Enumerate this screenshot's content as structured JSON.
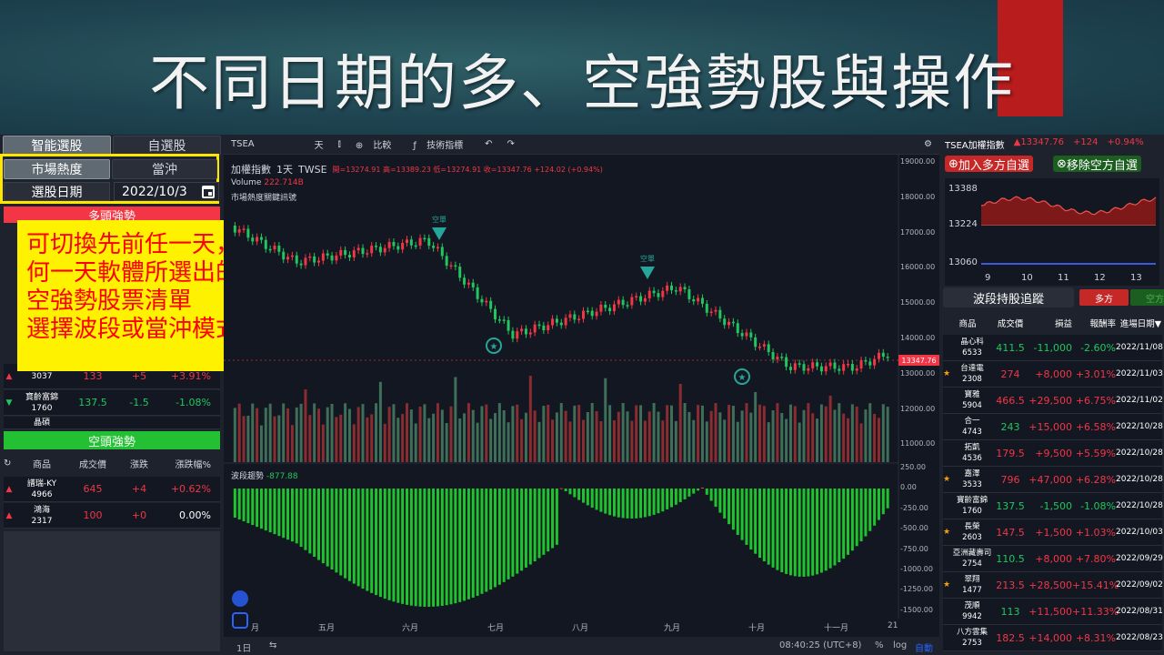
{
  "slide": {
    "title": "不同日期的多、空強勢股與操作"
  },
  "left_panel": {
    "tabs": [
      "智能選股",
      "自選股"
    ],
    "mode_tabs": [
      "市場熱度",
      "當沖"
    ],
    "date_label": "選股日期",
    "date_value": "2022/10/3",
    "bull_title": "多頭強勢",
    "bull_rows": [
      {
        "name": "",
        "code": "3037",
        "price": "133",
        "change": "+5",
        "pct": "+3.91%",
        "dir": "up"
      },
      {
        "name": "寶齡富錦",
        "code": "1760",
        "price": "137.5",
        "change": "-1.5",
        "pct": "-1.08%",
        "dir": "down"
      },
      {
        "name": "晶碩",
        "code": "",
        "price": "",
        "change": "",
        "pct": "",
        "dir": "up"
      }
    ],
    "bear_title": "空頭強勢",
    "columns": [
      "商品",
      "成交價",
      "漲跌",
      "漲跌幅%"
    ],
    "bear_rows": [
      {
        "name": "譜瑞-KY",
        "code": "4966",
        "price": "645",
        "change": "+4",
        "pct": "+0.62%",
        "dir": "up"
      },
      {
        "name": "鴻海",
        "code": "2317",
        "price": "100",
        "change": "+0",
        "pct": "0.00%",
        "dir": "up"
      }
    ],
    "overlay_lines": [
      "可切換先前任一天，看任",
      "何一天軟體所選出的多、",
      "空強勢股票清單",
      "選擇波段或當沖模式"
    ]
  },
  "chart": {
    "symbol": "TSEA",
    "toolbar": [
      "天",
      "比較",
      "技術指標"
    ],
    "legend_title": "加權指數",
    "legend_interval": "1天",
    "legend_exchange": "TWSE",
    "ohlc": [
      "開=13274.91",
      "高=13389.23",
      "低=13274.91",
      "收=13347.76",
      "+124.02 (+0.94%)"
    ],
    "volume_label": "Volume",
    "volume_value": "222.714B",
    "signal_label": "市場熱度關鍵訊號",
    "short_signal": "空單",
    "wave_label": "波段趨勢",
    "wave_value": "-877.88",
    "last_price": "13347.76",
    "price_ticks": [
      "19000.00",
      "18000.00",
      "17000.00",
      "16000.00",
      "15000.00",
      "14000.00",
      "13000.00",
      "12000.00",
      "11000.00"
    ],
    "wave_ticks": [
      "250.00",
      "0.00",
      "-250.00",
      "-500.00",
      "-750.00",
      "-1000.00",
      "-1250.00",
      "-1500.00"
    ],
    "months": [
      "五月",
      "六月",
      "七月",
      "八月",
      "九月",
      "十月",
      "十一月",
      "21"
    ],
    "month_partial": "月",
    "bottom": {
      "range": "1日",
      "time": "08:40:25 (UTC+8)",
      "pct": "%",
      "log": "log",
      "auto": "自動"
    }
  },
  "right_panel": {
    "index_name": "TSEA加權指數",
    "index_value": "▲13347.76",
    "index_change": "+124",
    "index_pct": "+0.94%",
    "add_long": "加入多方自選",
    "remove_short": "移除空方自選",
    "mini_ticks": [
      "13388",
      "13224",
      "13060"
    ],
    "mini_x": [
      "9",
      "10",
      "11",
      "12",
      "13"
    ],
    "track_title": "波段持股追蹤",
    "long_tab": "多方",
    "short_tab": "空方",
    "hold_columns": [
      "商品",
      "成交價",
      "損益",
      "報酬率",
      "進場日期▼"
    ],
    "holdings": [
      {
        "name": "晶心科",
        "code": "6533",
        "price": "411.5",
        "pl": "-11,000",
        "ret": "-2.60%",
        "date": "2022/11/08",
        "star": false,
        "dir": "down"
      },
      {
        "name": "台達電",
        "code": "2308",
        "price": "274",
        "pl": "+8,000",
        "ret": "+3.01%",
        "date": "2022/11/03",
        "star": true,
        "dir": "up"
      },
      {
        "name": "寶雅",
        "code": "5904",
        "price": "466.5",
        "pl": "+29,500",
        "ret": "+6.75%",
        "date": "2022/11/02",
        "star": false,
        "dir": "up"
      },
      {
        "name": "合一",
        "code": "4743",
        "price": "243",
        "pl": "+15,000",
        "ret": "+6.58%",
        "date": "2022/10/28",
        "star": false,
        "dir": "down"
      },
      {
        "name": "拓凱",
        "code": "4536",
        "price": "179.5",
        "pl": "+9,500",
        "ret": "+5.59%",
        "date": "2022/10/28",
        "star": false,
        "dir": "up"
      },
      {
        "name": "嘉澤",
        "code": "3533",
        "price": "796",
        "pl": "+47,000",
        "ret": "+6.28%",
        "date": "2022/10/28",
        "star": true,
        "dir": "up"
      },
      {
        "name": "寶齡富錦",
        "code": "1760",
        "price": "137.5",
        "pl": "-1,500",
        "ret": "-1.08%",
        "date": "2022/10/28",
        "star": false,
        "dir": "down"
      },
      {
        "name": "長榮",
        "code": "2603",
        "price": "147.5",
        "pl": "+1,500",
        "ret": "+1.03%",
        "date": "2022/10/03",
        "star": true,
        "dir": "up"
      },
      {
        "name": "亞洲藏壽司",
        "code": "2754",
        "price": "110.5",
        "pl": "+8,000",
        "ret": "+7.80%",
        "date": "2022/09/29",
        "star": false,
        "dir": "down"
      },
      {
        "name": "翠翔",
        "code": "1477",
        "price": "213.5",
        "pl": "+28,500",
        "ret": "+15.41%",
        "date": "2022/09/02",
        "star": true,
        "dir": "up"
      },
      {
        "name": "茂順",
        "code": "9942",
        "price": "113",
        "pl": "+11,500",
        "ret": "+11.33%",
        "date": "2022/08/31",
        "star": false,
        "dir": "down"
      },
      {
        "name": "八方雲集",
        "code": "2753",
        "price": "182.5",
        "pl": "+14,000",
        "ret": "+8.31%",
        "date": "2022/08/23",
        "star": false,
        "dir": "up"
      }
    ]
  },
  "colors": {
    "up": "#f23645",
    "down": "#22c55e",
    "bg": "#131722",
    "panel": "#1e222d",
    "highlight": "#fff200",
    "overlay_text": "#ff0000"
  }
}
